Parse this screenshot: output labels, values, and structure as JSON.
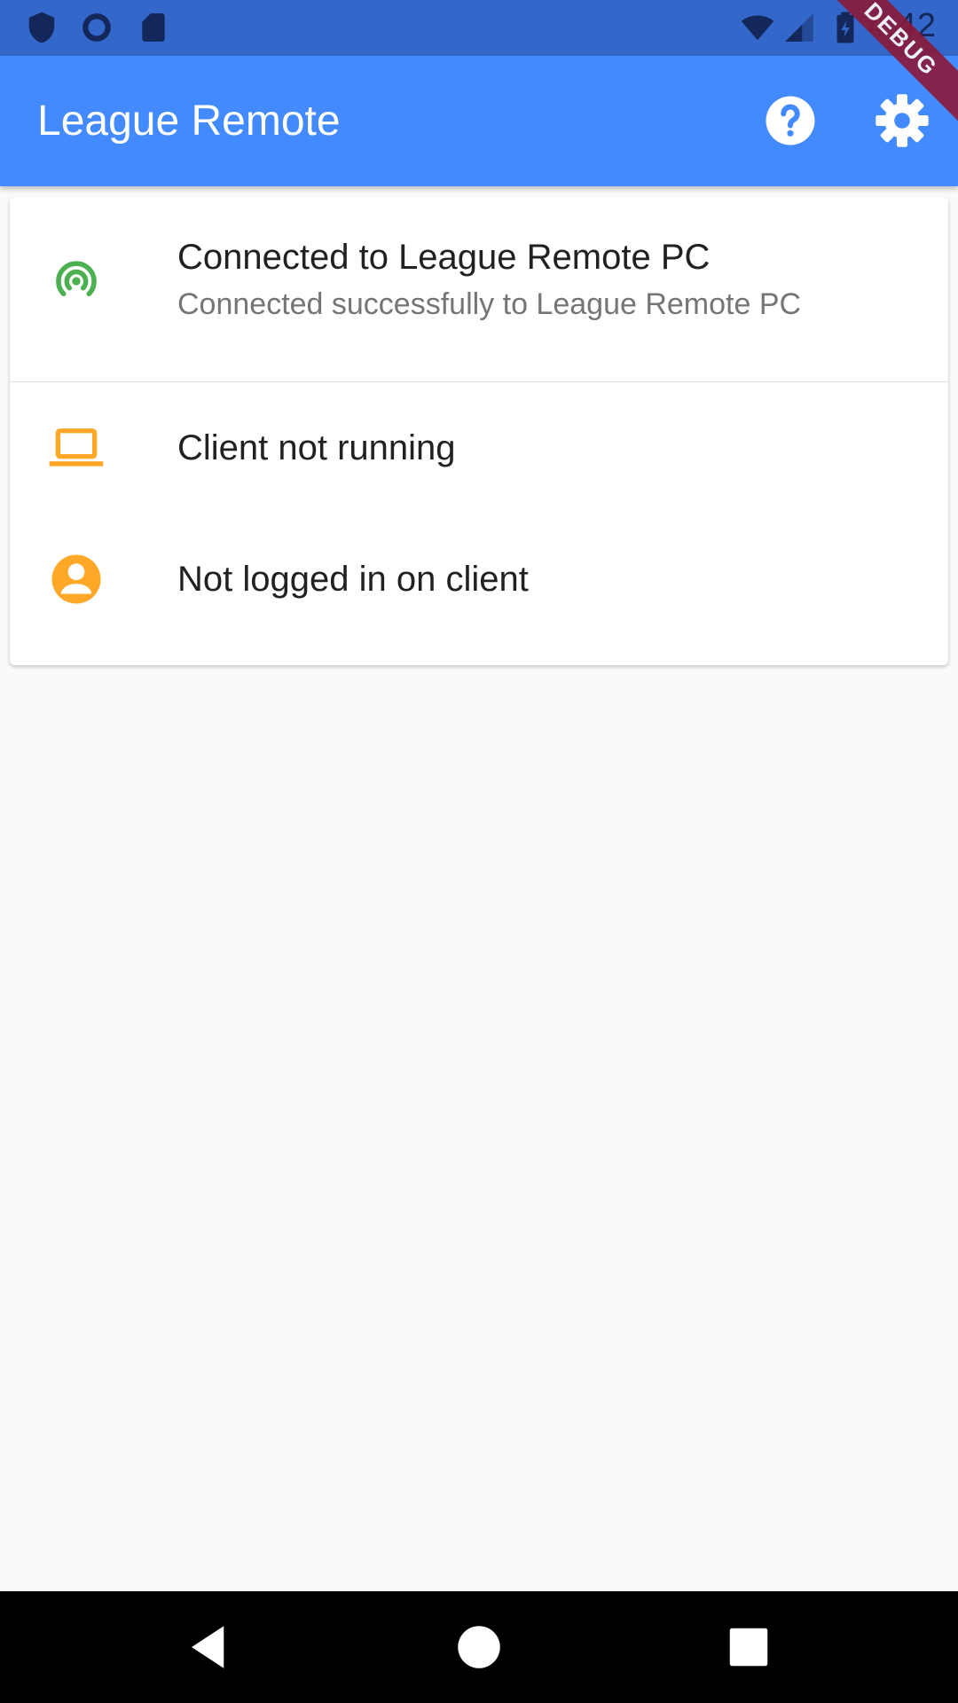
{
  "status_bar": {
    "time": "4:42",
    "icons": [
      "shield-icon",
      "circle-icon",
      "sd-card-icon",
      "wifi-icon",
      "cell-signal-icon",
      "battery-charging-icon"
    ]
  },
  "debug_banner": "DEBUG",
  "app_bar": {
    "title": "League Remote",
    "actions": [
      "help-icon",
      "settings-icon"
    ],
    "color": "#448aff"
  },
  "status_list": [
    {
      "icon": "broadcast-icon",
      "icon_color": "#4caf50",
      "title": "Connected to League Remote PC",
      "subtitle": "Connected successfully to League Remote PC"
    },
    {
      "icon": "laptop-icon",
      "icon_color": "#ffa726",
      "title": "Client not running"
    },
    {
      "icon": "account-circle-icon",
      "icon_color": "#ffa726",
      "title": "Not logged in on client"
    }
  ],
  "nav_bar": {
    "buttons": [
      "back-icon",
      "home-icon",
      "recents-icon"
    ]
  }
}
